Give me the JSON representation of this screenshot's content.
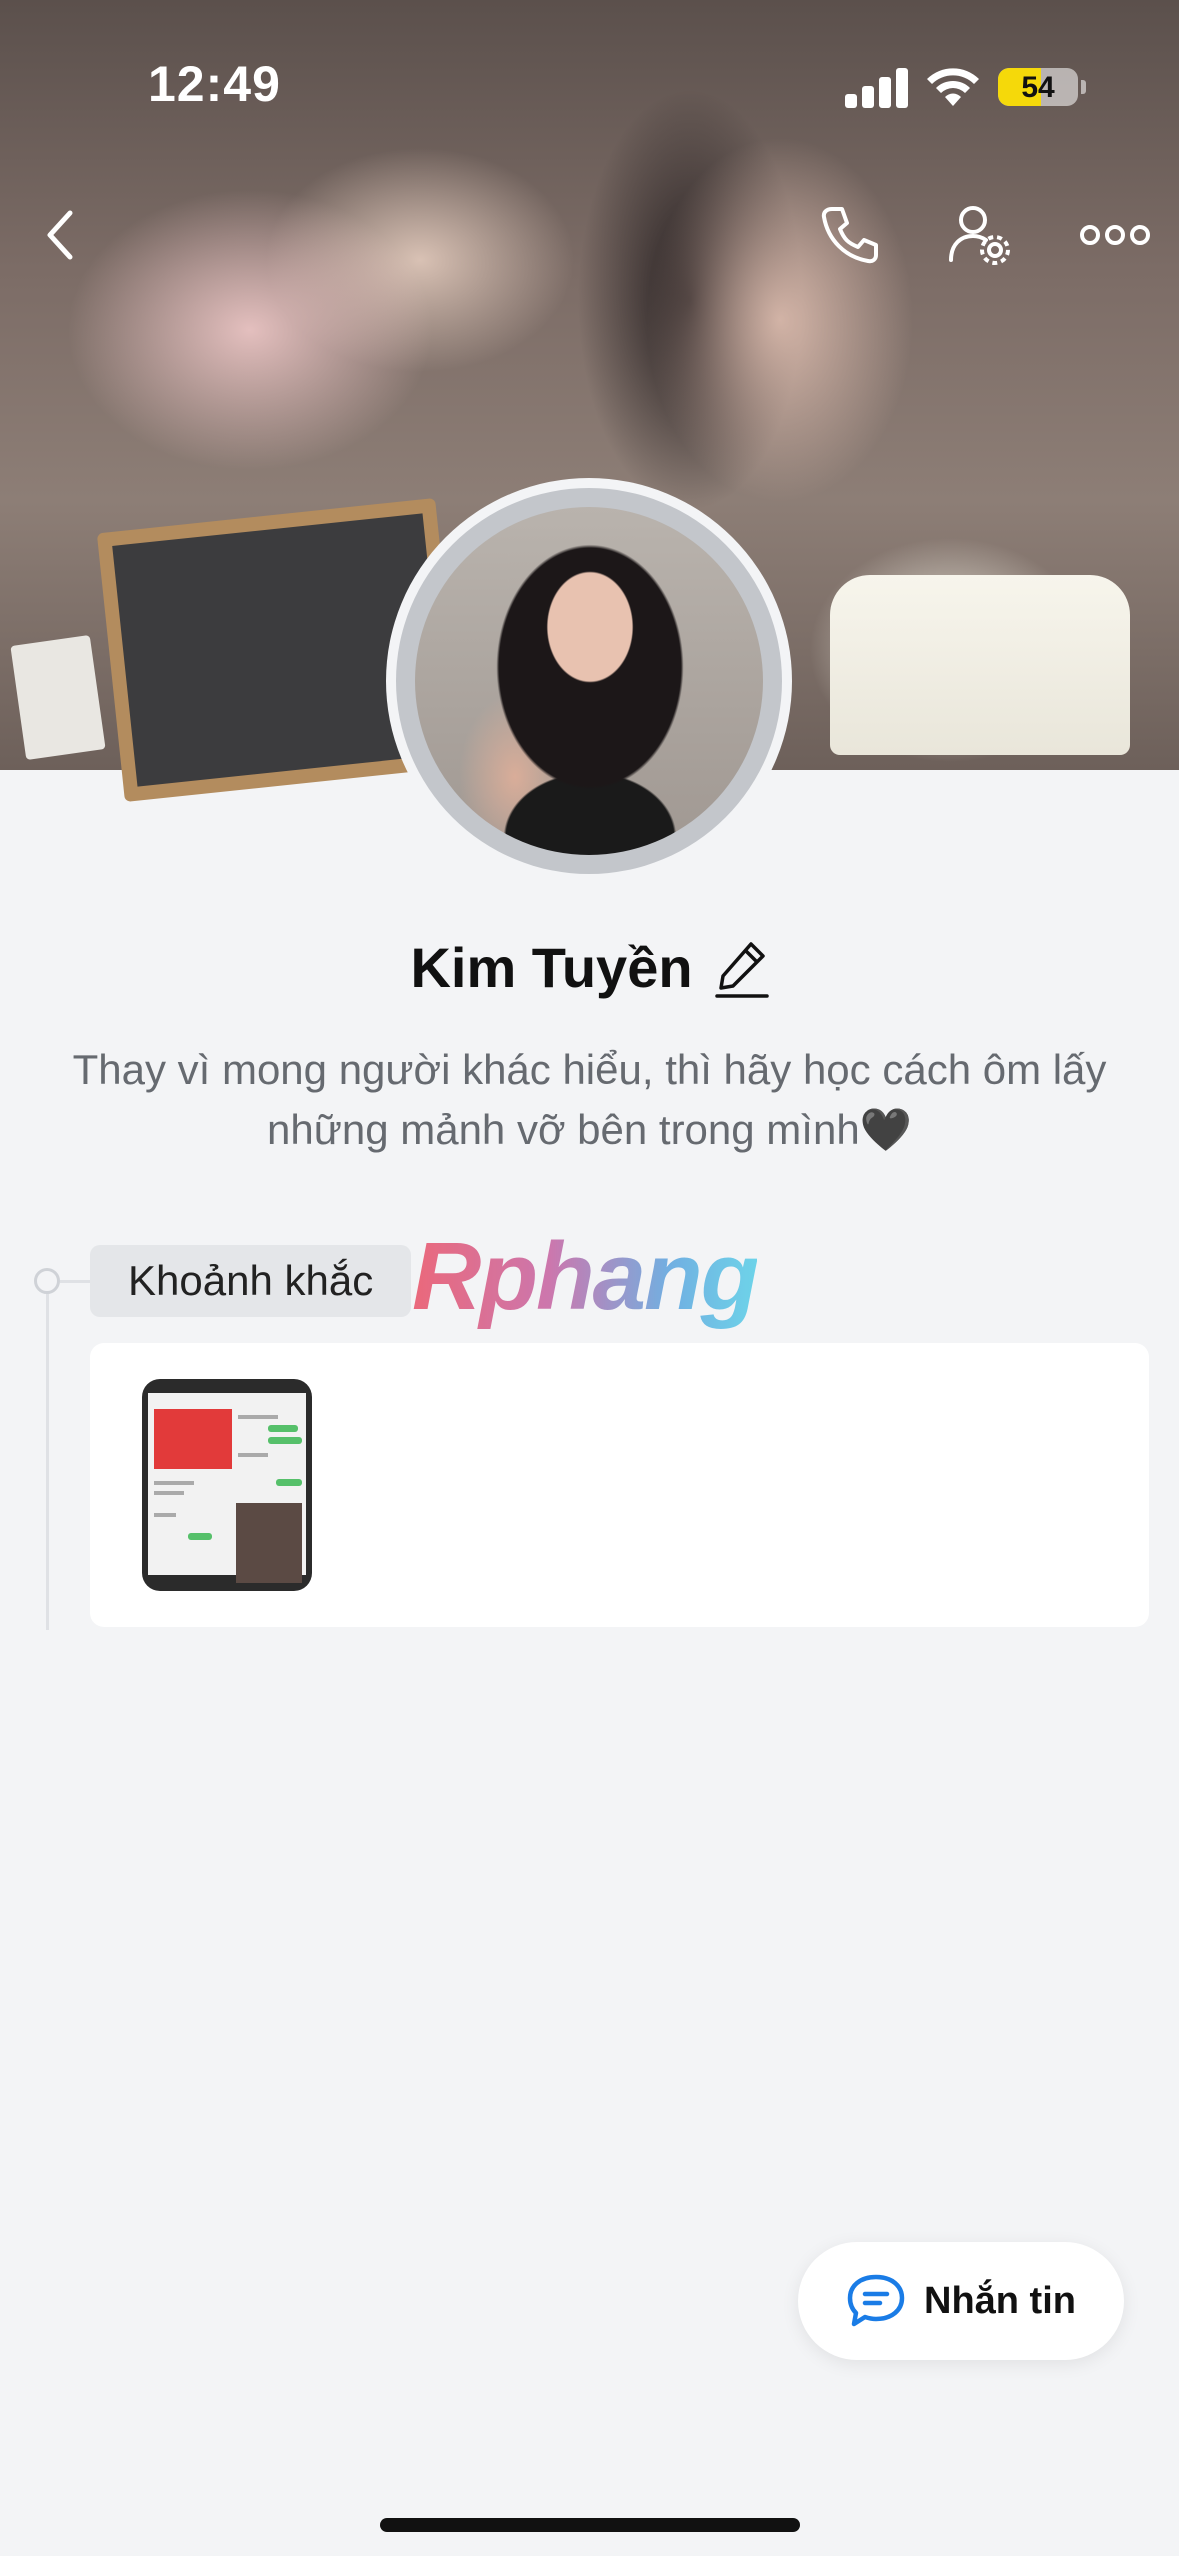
{
  "status_bar": {
    "time": "12:49",
    "battery_level": "54",
    "battery_fraction": 0.54,
    "icons": [
      "cellular-signal-icon",
      "wifi-icon",
      "battery-icon"
    ]
  },
  "nav": {
    "back_icon": "chevron-left-icon",
    "call_icon": "phone-icon",
    "user_settings_icon": "user-settings-icon",
    "more_icon": "more-dots-icon"
  },
  "profile": {
    "name": "Kim Tuyền",
    "edit_icon": "pencil-icon",
    "bio": "Thay vì mong người khác hiểu, thì hãy học cách ôm lấy những mảnh vỡ bên trong mình🖤"
  },
  "moments": {
    "title": "Khoảnh khắc",
    "watermark": "Rphang"
  },
  "message_button": {
    "label": "Nhắn tin",
    "icon": "chat-bubble-icon"
  },
  "colors": {
    "background": "#f3f4f6",
    "accent_blue": "#1a7ce6",
    "battery_yellow": "#f5d90a"
  }
}
